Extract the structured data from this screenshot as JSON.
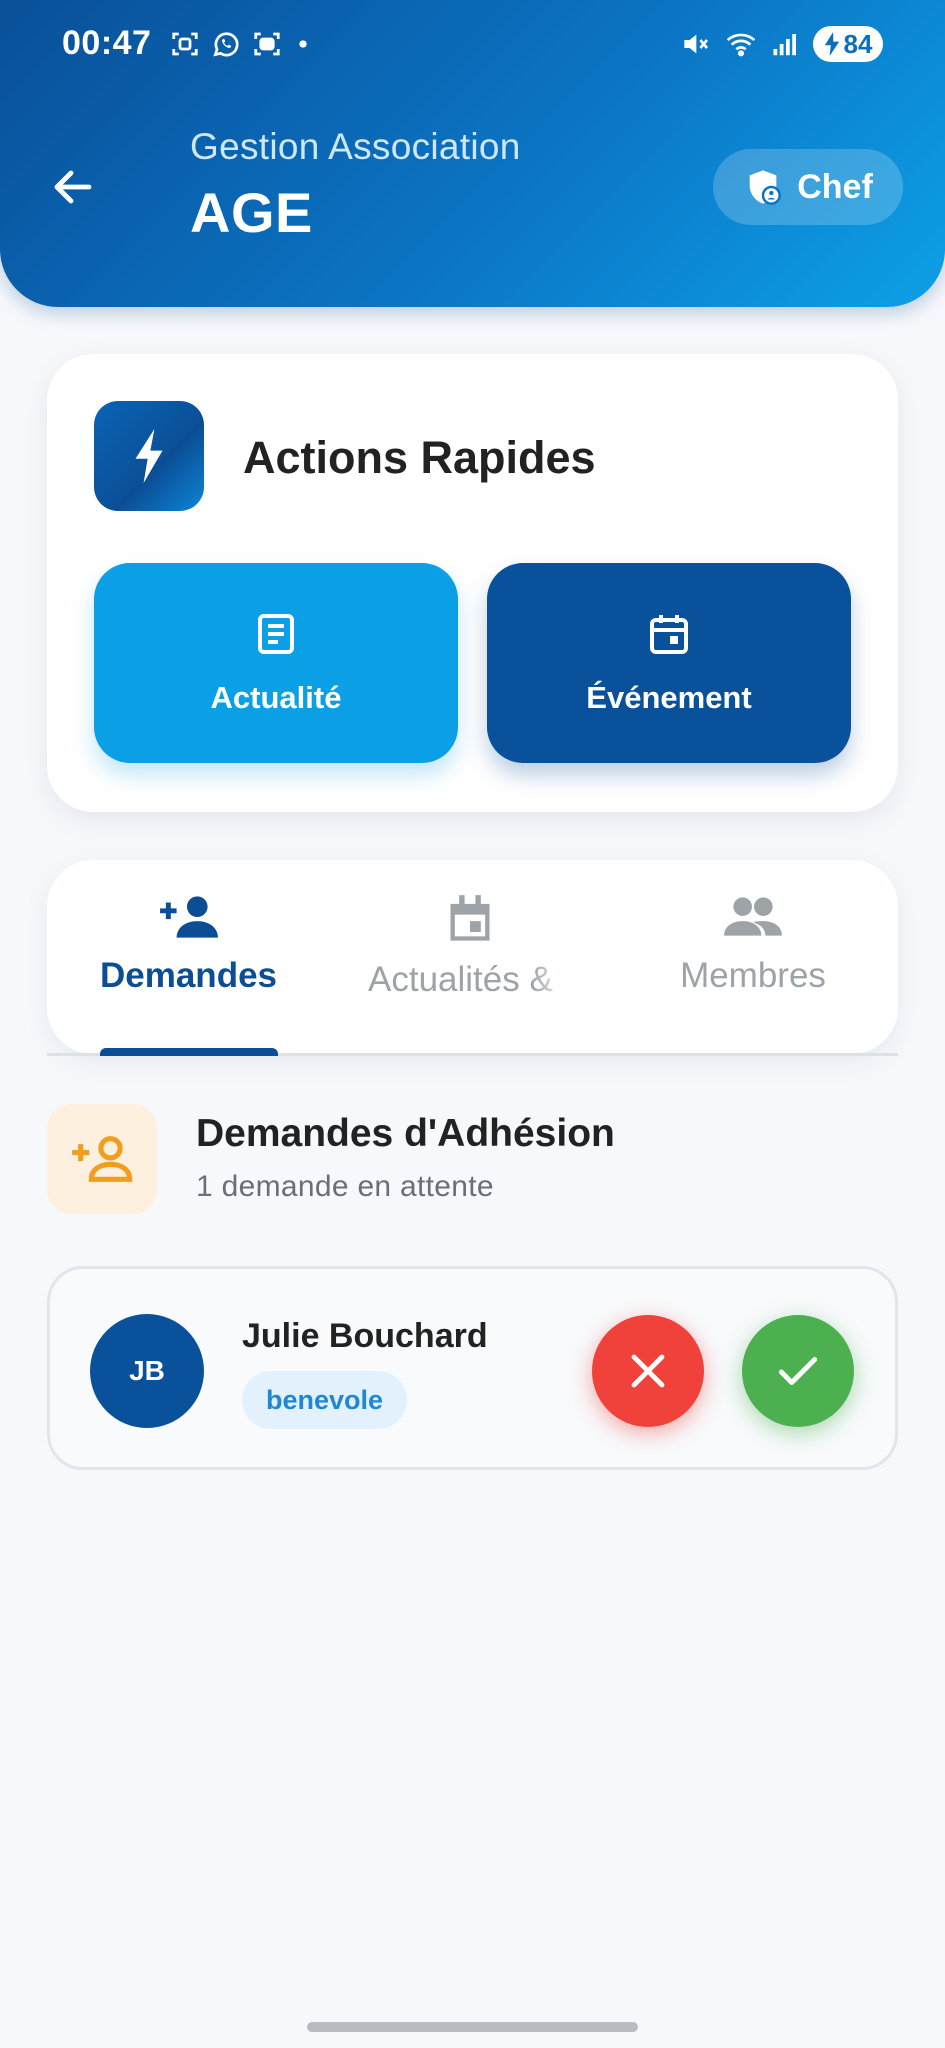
{
  "status_bar": {
    "time": "00:47",
    "battery": "84",
    "icons": [
      "screenshot-icon",
      "whatsapp-icon",
      "screen-record-icon",
      "dot-icon",
      "mute-icon",
      "wifi-icon",
      "signal-icon",
      "battery-icon"
    ]
  },
  "header": {
    "subtitle": "Gestion Association",
    "title": "AGE",
    "role_badge": "Chef",
    "colors": {
      "gradient_start": "#0a4f98",
      "gradient_end": "#0da0e6"
    }
  },
  "quick_actions": {
    "title": "Actions Rapides",
    "buttons": [
      {
        "label": "Actualité",
        "icon": "article-icon",
        "color": "#0ba0e6"
      },
      {
        "label": "Événement",
        "icon": "calendar-icon",
        "color": "#0a519b"
      }
    ]
  },
  "tabs": [
    {
      "label": "Demandes",
      "icon": "person-add-icon",
      "active": true
    },
    {
      "label": "Actualités &",
      "icon": "event-icon",
      "active": false
    },
    {
      "label": "Membres",
      "icon": "group-icon",
      "active": false
    }
  ],
  "section": {
    "title": "Demandes d'Adhésion",
    "subtitle": "1 demande en attente"
  },
  "requests": [
    {
      "initials": "JB",
      "name": "Julie Bouchard",
      "role": "benevole"
    }
  ],
  "colors": {
    "primary": "#0b4e96",
    "accent": "#0ba0e6",
    "reject": "#f0413b",
    "accept": "#4caf50",
    "orange": "#f39c1e"
  }
}
